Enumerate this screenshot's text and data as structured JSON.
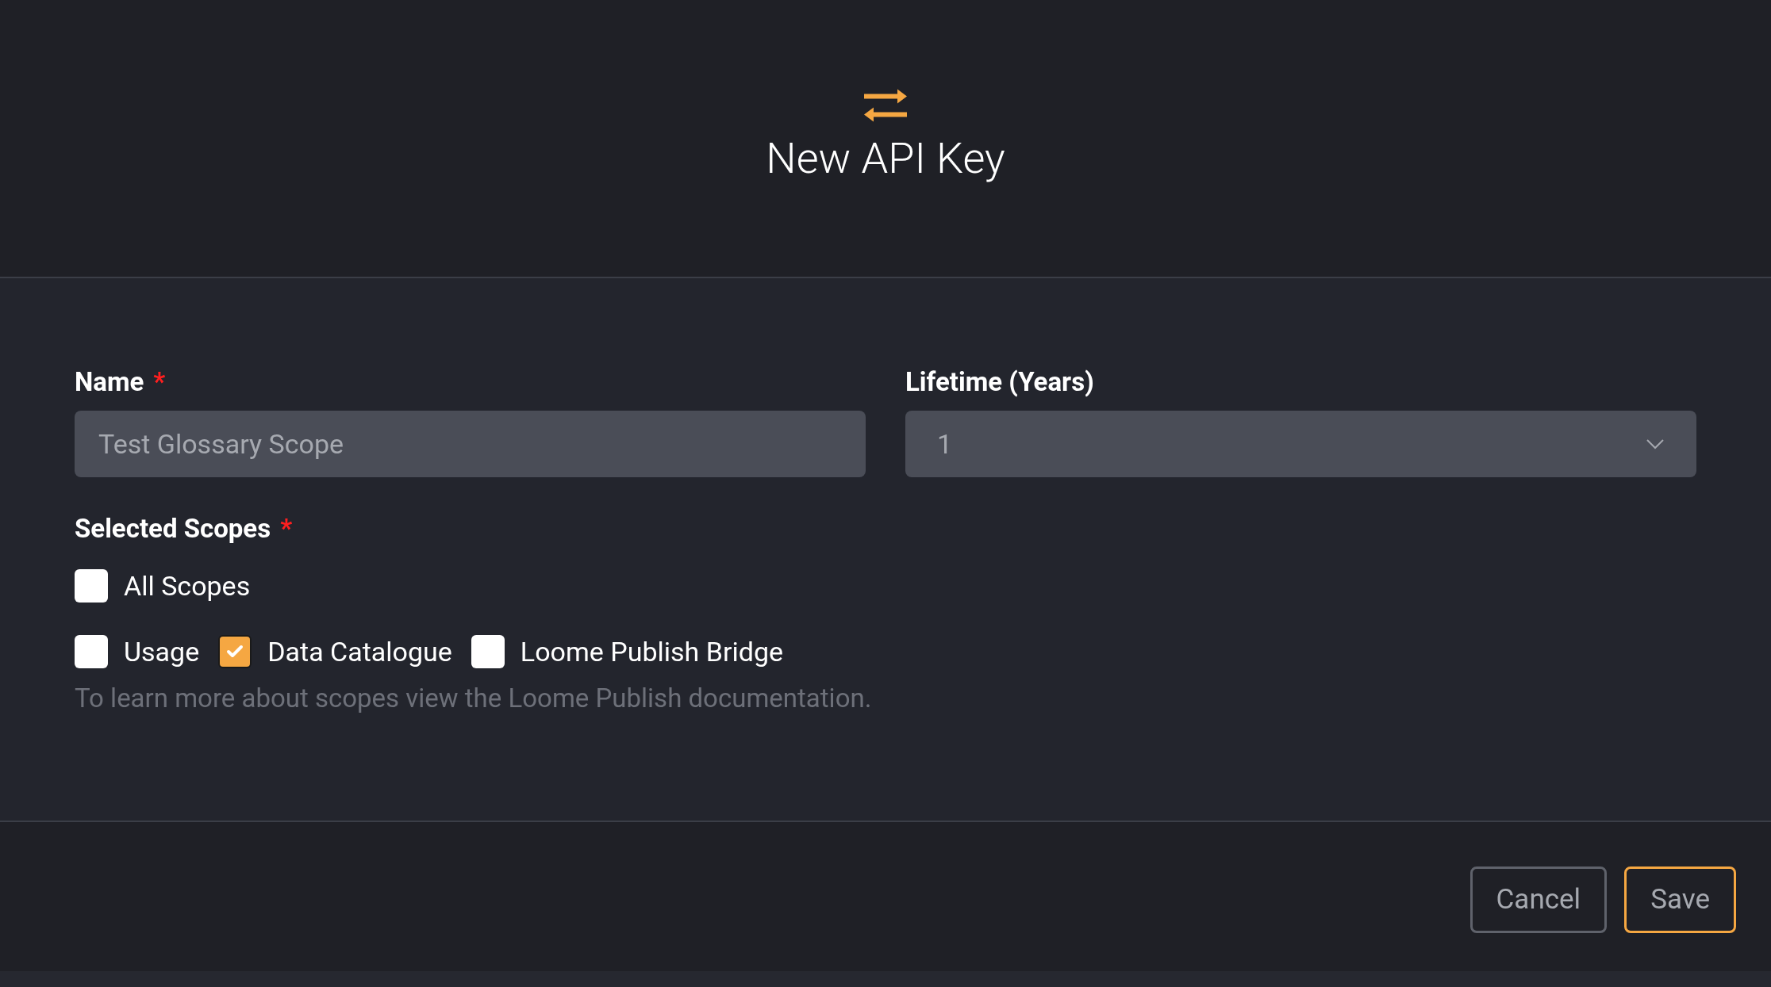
{
  "dialog": {
    "title": "New API Key"
  },
  "name_field": {
    "label": "Name",
    "required_mark": "*",
    "value": "Test Glossary Scope"
  },
  "lifetime_field": {
    "label": "Lifetime (Years)",
    "value": "1"
  },
  "scopes": {
    "label": "Selected Scopes",
    "required_mark": "*",
    "all": {
      "label": "All Scopes",
      "checked": false
    },
    "items": [
      {
        "label": "Usage",
        "checked": false
      },
      {
        "label": "Data Catalogue",
        "checked": true
      },
      {
        "label": "Loome Publish Bridge",
        "checked": false
      }
    ],
    "help": "To learn more about scopes view the Loome Publish documentation."
  },
  "buttons": [
    {
      "label": "Cancel",
      "kind": "secondary"
    },
    {
      "label": "Save",
      "kind": "primary"
    }
  ]
}
